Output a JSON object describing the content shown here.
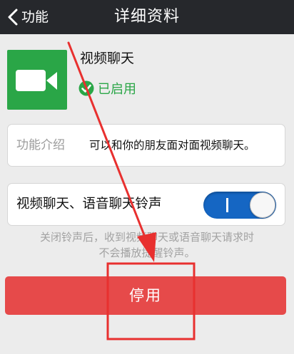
{
  "nav": {
    "back_label": "功能",
    "title": "详细资料"
  },
  "feature": {
    "icon": "video-camera-icon",
    "name": "视频聊天",
    "status": "已启用"
  },
  "intro": {
    "label": "功能介绍",
    "text": "可以和你的朋友面对面视频聊天。"
  },
  "ringtone": {
    "label": "视频聊天、语音聊天铃声",
    "enabled": true
  },
  "hint": {
    "line1": "关闭铃声后，收到视频聊天或语音聊天请求时",
    "line2": "不会播放提醒铃声。"
  },
  "actions": {
    "disable_label": "停用"
  },
  "colors": {
    "nav_bg": "#26282c",
    "brand_green": "#2aa647",
    "toggle_blue": "#1566c3",
    "danger_red": "#e64a4a",
    "annotation_red": "#e8302f"
  }
}
